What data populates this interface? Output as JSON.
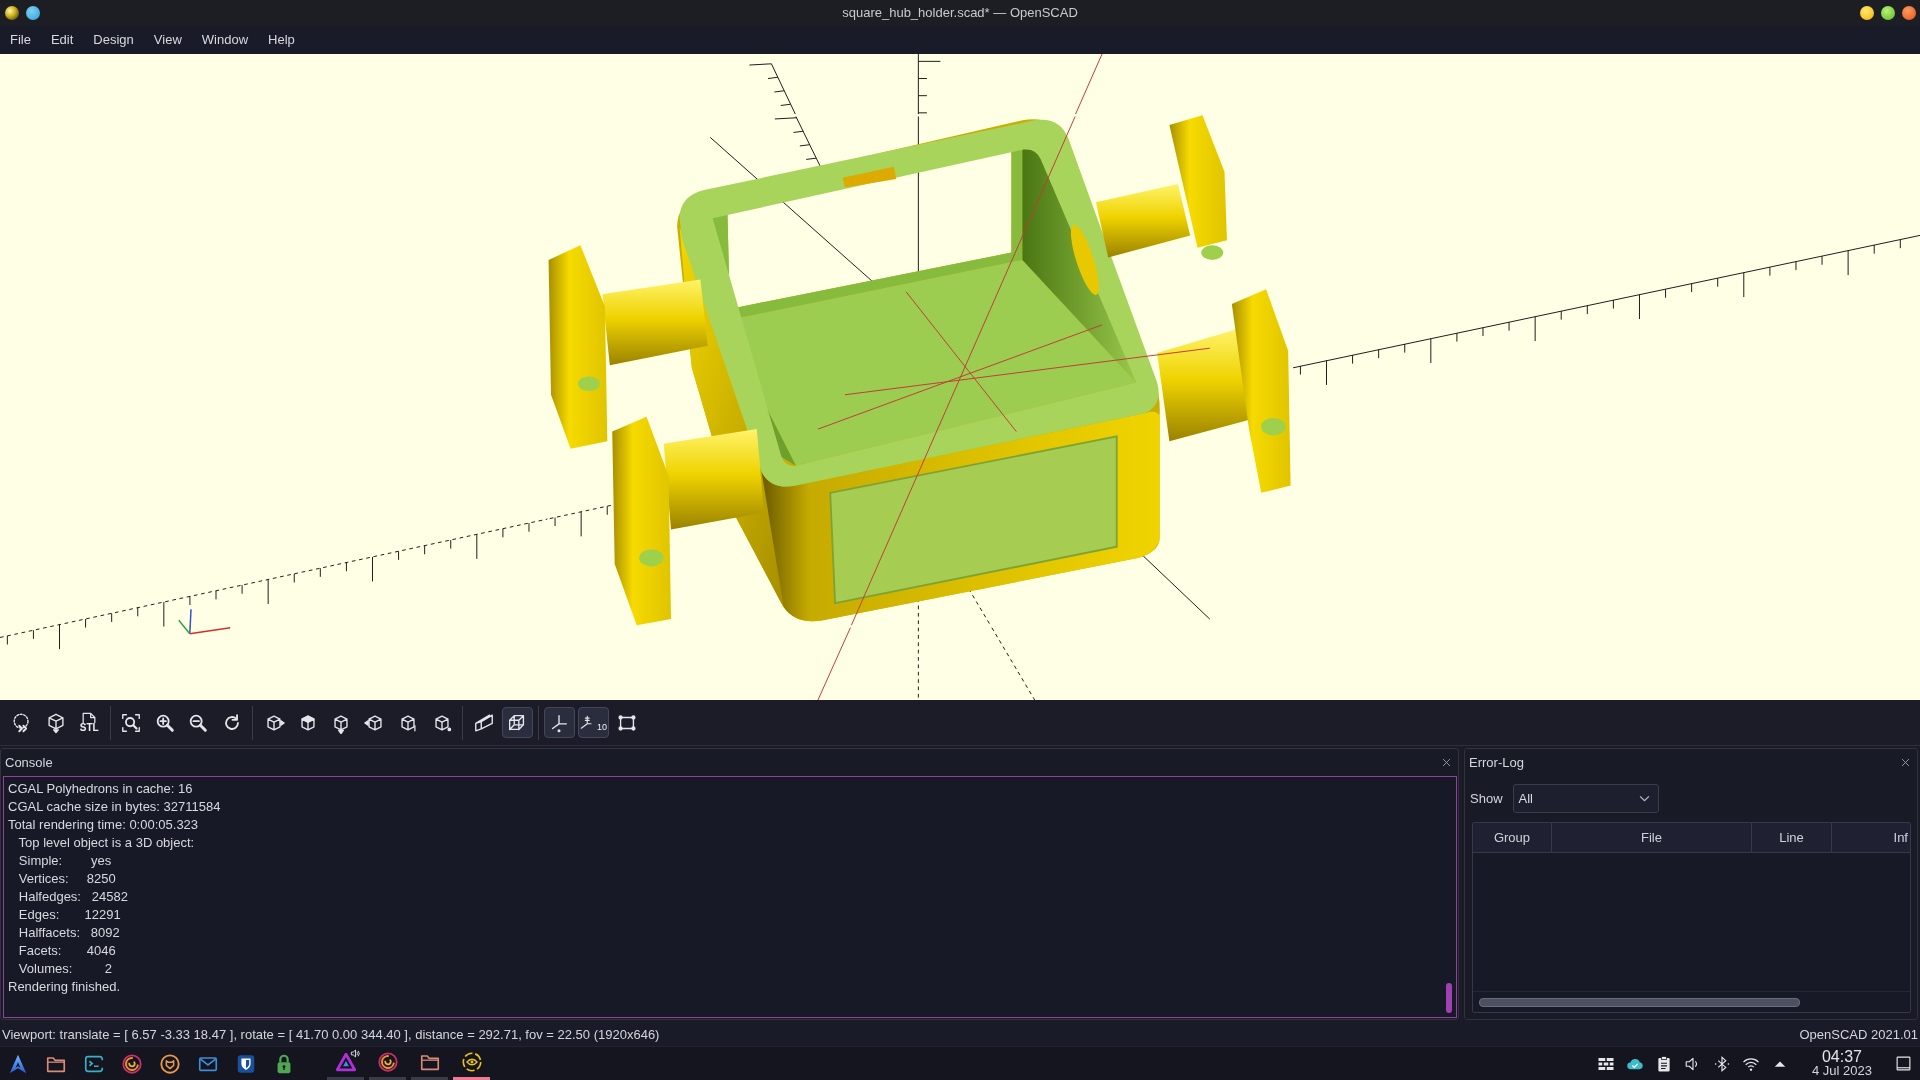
{
  "window": {
    "title": "square_hub_holder.scad* — OpenSCAD"
  },
  "menu": [
    "File",
    "Edit",
    "Design",
    "View",
    "Window",
    "Help"
  ],
  "toolbar": [
    {
      "kind": "button"
    },
    {
      "kind": "button"
    },
    {
      "kind": "button",
      "label": "STL"
    },
    {
      "kind": "separator"
    },
    {
      "kind": "button"
    },
    {
      "kind": "button"
    },
    {
      "kind": "button"
    },
    {
      "kind": "button"
    },
    {
      "kind": "separator"
    },
    {
      "kind": "button"
    },
    {
      "kind": "button"
    },
    {
      "kind": "button"
    },
    {
      "kind": "button"
    },
    {
      "kind": "button"
    },
    {
      "kind": "button"
    },
    {
      "kind": "separator"
    },
    {
      "kind": "toggle",
      "active": false
    },
    {
      "kind": "toggle",
      "active": true
    },
    {
      "kind": "separator"
    },
    {
      "kind": "toggle",
      "active": true
    },
    {
      "kind": "toggle",
      "active": true,
      "label": "10"
    },
    {
      "kind": "toggle",
      "active": false
    }
  ],
  "console": {
    "title": "Console",
    "lines": [
      "CGAL Polyhedrons in cache: 16",
      "CGAL cache size in bytes: 32711584",
      "Total rendering time: 0:00:05.323",
      "   Top level object is a 3D object:",
      "   Simple:        yes",
      "   Vertices:     8250",
      "   Halfedges:   24582",
      "   Edges:       12291",
      "   Halffacets:   8092",
      "   Facets:       4046",
      "   Volumes:         2",
      "Rendering finished."
    ]
  },
  "error_log": {
    "title": "Error-Log",
    "filter": {
      "label": "Show",
      "value": "All"
    },
    "columns": [
      "Group",
      "File",
      "Line",
      "Inf"
    ]
  },
  "status_bar": {
    "viewport": "Viewport: translate = [ 6.57 -3.33 18.47 ], rotate = [ 41.70 0.00 344.40 ], distance = 292.71, fov = 22.50 (1920x646)",
    "version": "OpenSCAD 2021.01"
  },
  "taskbar": {
    "tasks": [
      {
        "selected": false
      },
      {
        "selected": false
      },
      {
        "selected": false
      },
      {
        "selected": true
      }
    ],
    "clock": {
      "time": "04:37",
      "date": "4 Jul 2023"
    }
  }
}
